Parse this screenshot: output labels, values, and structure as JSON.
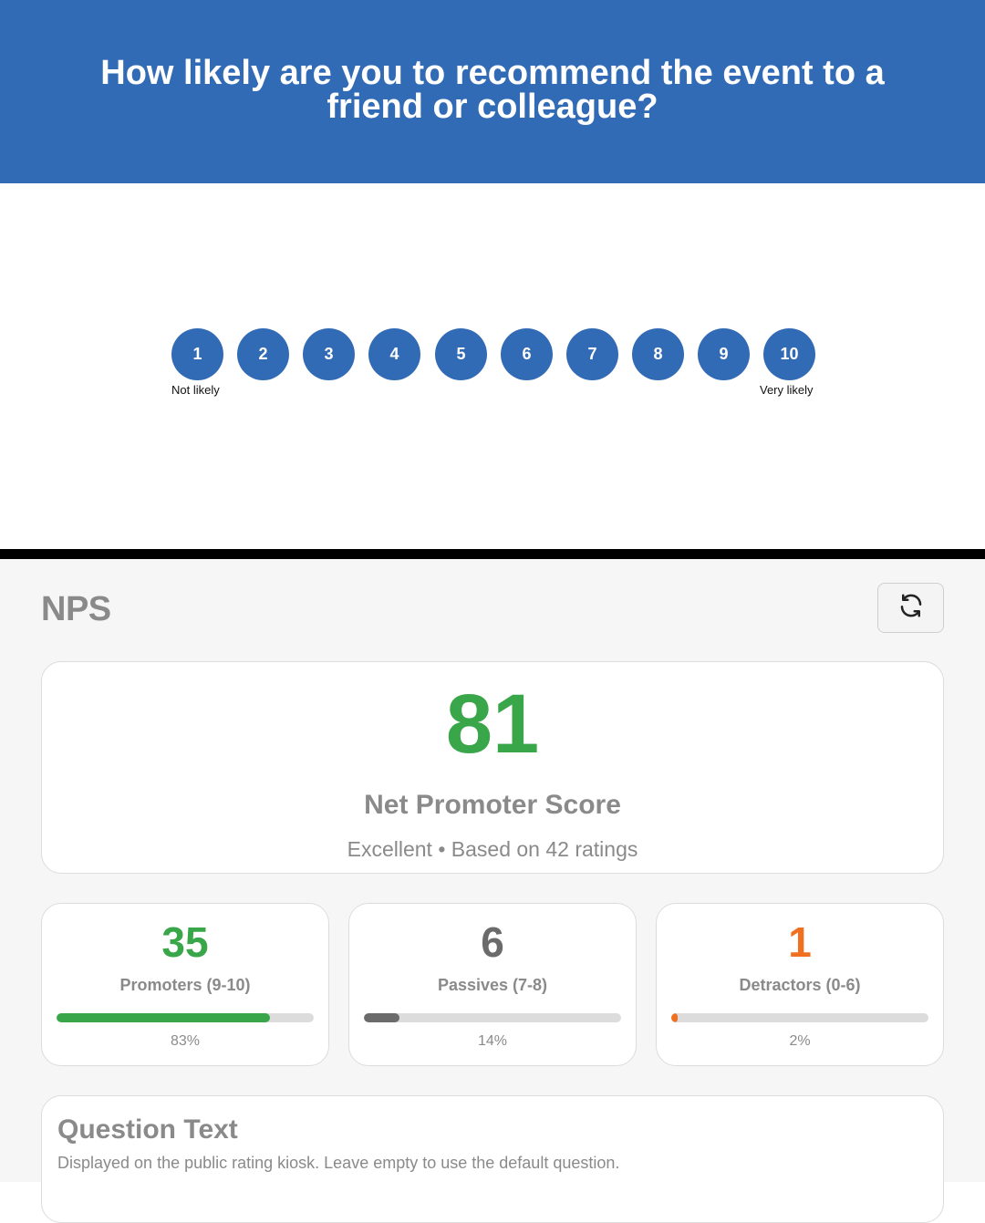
{
  "kiosk": {
    "question": "How likely are you to recommend the event to a friend or colleague?",
    "scale": [
      "1",
      "2",
      "3",
      "4",
      "5",
      "6",
      "7",
      "8",
      "9",
      "10"
    ],
    "low_label": "Not likely",
    "high_label": "Very likely",
    "accent": "#326bb5"
  },
  "admin": {
    "title": "NPS",
    "refresh_icon": "refresh-icon",
    "score": {
      "value": "81",
      "label": "Net Promoter Score",
      "subtitle": "Excellent • Based on 42 ratings",
      "color": "#3aa64a"
    },
    "stats": [
      {
        "count": "35",
        "label": "Promoters (9-10)",
        "percent_text": "83%",
        "fraction": 0.83,
        "color": "#3aa64a"
      },
      {
        "count": "6",
        "label": "Passives (7-8)",
        "percent_text": "14%",
        "fraction": 0.14,
        "color": "#6b6b6b"
      },
      {
        "count": "1",
        "label": "Detractors (0-6)",
        "percent_text": "2%",
        "fraction": 0.02,
        "color": "#f07020"
      }
    ],
    "question_text": {
      "title": "Question Text",
      "description": "Displayed on the public rating kiosk. Leave empty to use the default question."
    }
  }
}
